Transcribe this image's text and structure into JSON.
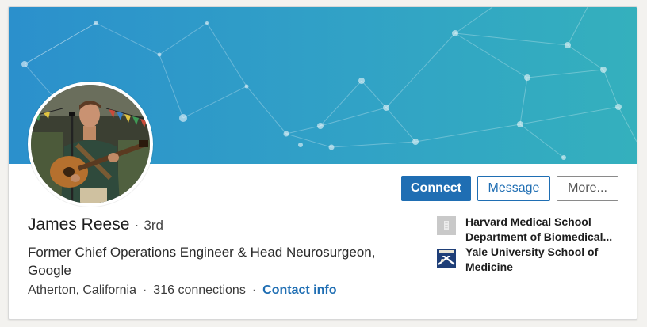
{
  "profile": {
    "name": "James Reese",
    "degree": "3rd",
    "separator": "·",
    "headline": "Former Chief Operations Engineer & Head Neurosurgeon, Google",
    "location": "Atherton, California",
    "connections": "316 connections",
    "contact_label": "Contact info"
  },
  "actions": {
    "connect": "Connect",
    "message": "Message",
    "more": "More..."
  },
  "education": [
    {
      "name": "Harvard Medical School Department of Biomedical...",
      "logo": "building-icon"
    },
    {
      "name": "Yale University School of Medicine",
      "logo": "yale-shield-icon"
    }
  ],
  "colors": {
    "banner_start": "#2b90cc",
    "banner_end": "#34b0bd",
    "primary": "#1f6eb3"
  }
}
